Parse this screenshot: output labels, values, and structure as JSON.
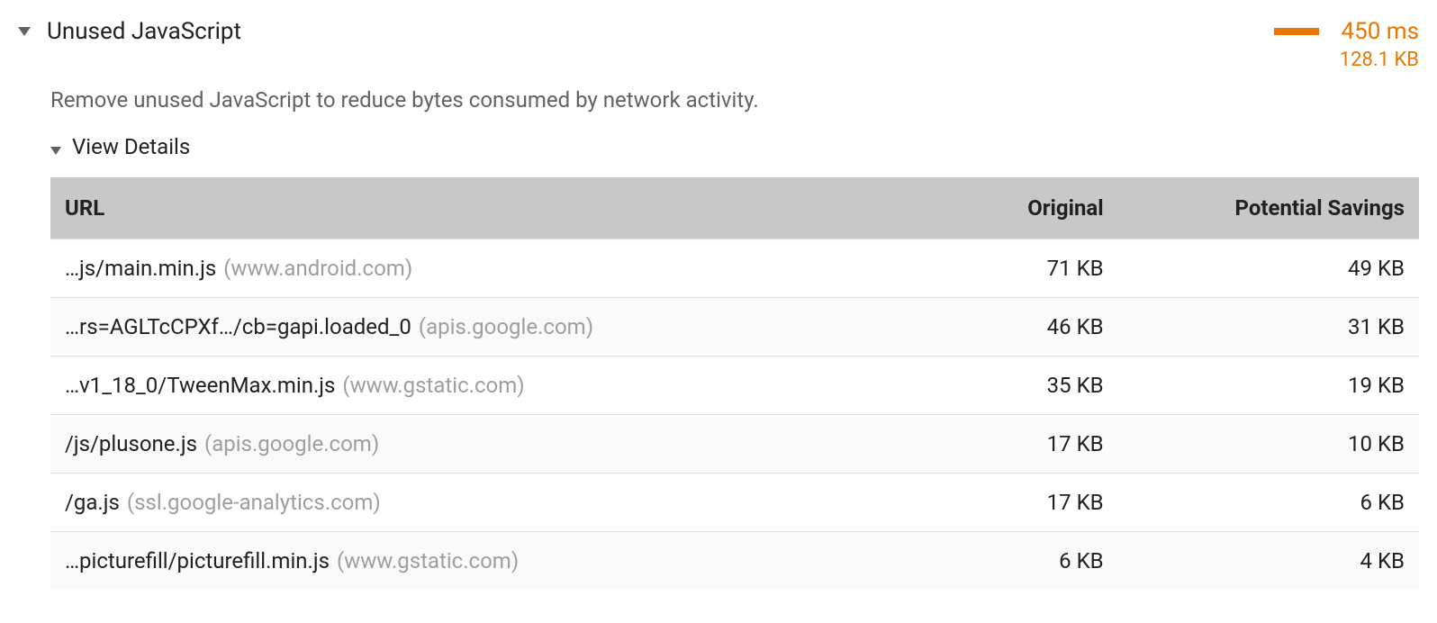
{
  "audit": {
    "title": "Unused JavaScript",
    "time": "450 ms",
    "size": "128.1 KB",
    "description": "Remove unused JavaScript to reduce bytes consumed by network activity.",
    "details_label": "View Details"
  },
  "table": {
    "headers": {
      "url": "URL",
      "original": "Original",
      "savings": "Potential Savings"
    },
    "rows": [
      {
        "path": "…js/main.min.js",
        "host": "(www.android.com)",
        "original": "71 KB",
        "savings": "49 KB"
      },
      {
        "path": "…rs=AGLTcCPXf…/cb=gapi.loaded_0",
        "host": "(apis.google.com)",
        "original": "46 KB",
        "savings": "31 KB"
      },
      {
        "path": "…v1_18_0/TweenMax.min.js",
        "host": "(www.gstatic.com)",
        "original": "35 KB",
        "savings": "19 KB"
      },
      {
        "path": "/js/plusone.js",
        "host": "(apis.google.com)",
        "original": "17 KB",
        "savings": "10 KB"
      },
      {
        "path": "/ga.js",
        "host": "(ssl.google-analytics.com)",
        "original": "17 KB",
        "savings": "6 KB"
      },
      {
        "path": "…picturefill/picturefill.min.js",
        "host": "(www.gstatic.com)",
        "original": "6 KB",
        "savings": "4 KB"
      }
    ]
  }
}
